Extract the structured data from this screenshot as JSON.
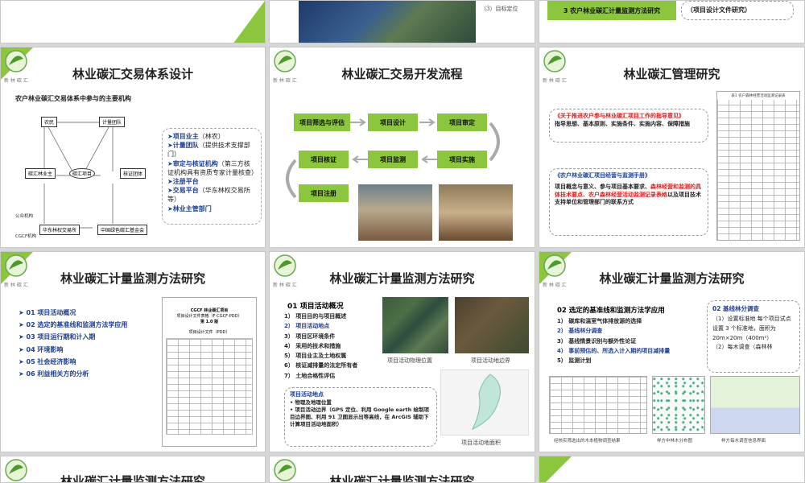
{
  "top_row": {
    "s2_caption": "（3）目标定位",
    "s3_step": "3  农户林业碳汇计量监测方法研究",
    "s3_note": "（项目设计文件研究）"
  },
  "slide_common": {
    "logo_sub": "新 林  碳 汇",
    "logo_text": "林业"
  },
  "slide4": {
    "title_prefix": "林业",
    "title": "碳汇交易体系设计",
    "subtitle": "农户林业碳汇交易体系中参与的主要机构",
    "nodes": [
      "农民",
      "计量团队",
      "碳汇林业主",
      "碳汇项目",
      "核证团体",
      "华东林权交易所",
      "中国绿色碳汇基金会",
      "公众机构",
      "CGCF机构"
    ],
    "list": [
      {
        "head": "项目业主",
        "rest": "（林农）"
      },
      {
        "head": "计量团队",
        "rest": "（提供技术支撑部门）"
      },
      {
        "head": "审定与核证机构",
        "rest": "（第三方核证机构具有资质专家计量核查）"
      },
      {
        "head": "注册平台",
        "rest": ""
      },
      {
        "head": "交易平台",
        "rest": "（华东林权交易所等）"
      },
      {
        "head": "林业主管部门",
        "rest": ""
      }
    ]
  },
  "slide5": {
    "title": "碳汇交易开发流程",
    "steps": [
      "项目筛选与评估",
      "项目设计",
      "项目审定",
      "项目核证",
      "项目监测",
      "项目实施",
      "项目注册"
    ]
  },
  "slide6": {
    "title": "碳汇管理研究",
    "box1_title": "《关于推进农户参与林业碳汇项目工作的指导意见》",
    "box1_body": "指导思想、基本原则、实施条件、实施内容、保障措施",
    "box2_title": "《农户林业碳汇项目经营与监测手册》",
    "box2_body_a": "项目概念与意义、参与项目基本要求、",
    "box2_red_a": "森林经营和监测的具体技术要点、农户森林经营活动监测记录表格",
    "box2_body_b": "以及项目技术支持单位和管理部门的联系方式",
    "table_title": "表1 农户森林经营活动监测记录表"
  },
  "slide7": {
    "title": "碳汇计量监测方法研究",
    "items": [
      "01  项目活动概况",
      "02  选定的基准线和监测方法学应用",
      "03  项目运行期和计入期",
      "04  环境影响",
      "05  社会经济影响",
      "06  利益相关方的分析"
    ],
    "doc_title": "CGCF 林业碳汇项目",
    "doc_sub": "项目设计文件表格（F-CGCF-PDD）",
    "doc_ver": "第 1.0 版",
    "doc_section": "项目设计文件（PDD）"
  },
  "slide8": {
    "title": "碳汇计量监测方法研究",
    "heading": "01 项目活动概况",
    "items": [
      "1） 项目目的与项目概述",
      "2） 项目活动地点",
      "3） 项目区环境条件",
      "4） 采用的技术和措施",
      "5） 项目业主及土地权属",
      "6） 核证减排量的法定所有者",
      "7） 土地合格性评估"
    ],
    "cap1": "项目活动物理位置",
    "cap2": "项目活动地边界",
    "box_title": "项目活动地点",
    "box_line1": "物理及地理位置",
    "box_line2": "项目活动边界（GPS 定位、利用 Google earth 绘制项目边界图、利用 91 卫图显示出等高线，在 ArcGIS 辅助下计算项目活动地面积）",
    "cap3": "项目活动地面积"
  },
  "slide9": {
    "title": "碳汇计量监测方法研究",
    "heading": "02  选定的基准线和监测方法学应用",
    "items": [
      "1）  碳库和温室气体排放源的选择",
      "2）  基线林分调查",
      "3）  基线情景识别与额外性论证",
      "4）  事前预估的、所选入计入期的项目减排量",
      "5）  监测计划"
    ],
    "box_title": "02  基线林分调查",
    "box_body": "（1）设置标准地  每个项目试点设置 3 个标准地，面积为 20m×20m（400m²）",
    "box_body2": "（2）每木调查（森林林",
    "cap1": "经核实筛选出的木本植物调查结果",
    "cap2": "样方中林木分布图",
    "cap3": "样方每木调查信息界面"
  },
  "bottom": {
    "title1": "碳汇计量监测方法研究",
    "title2": "碳汇计量监测方法研究"
  }
}
